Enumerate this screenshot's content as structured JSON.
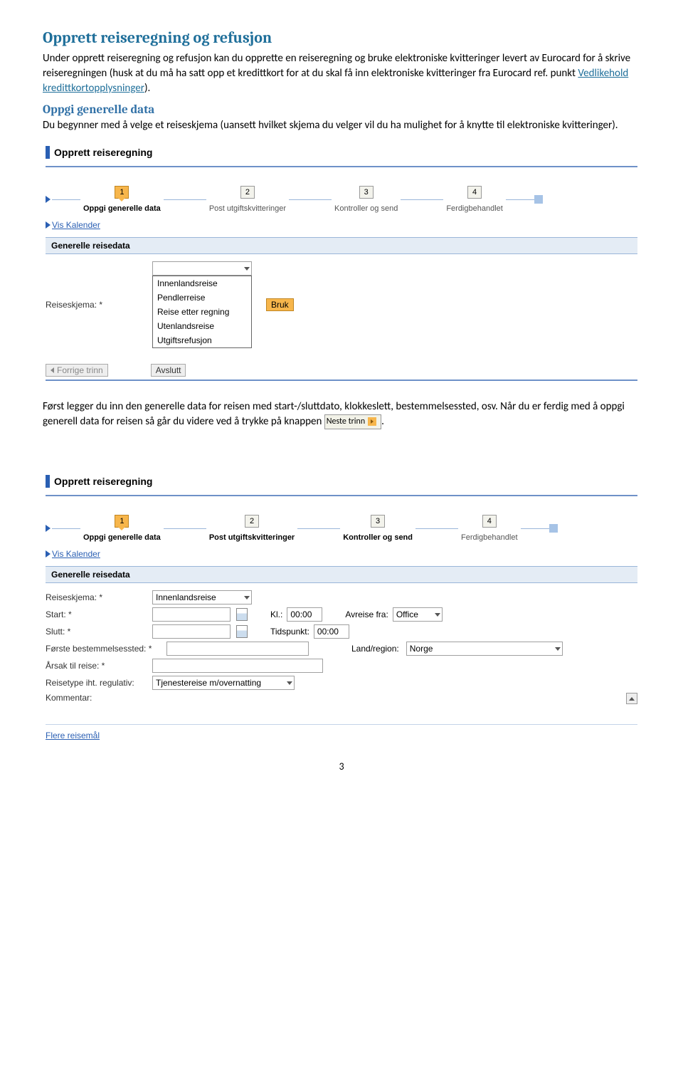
{
  "doc": {
    "h1": "Opprett reiseregning og refusjon",
    "p1a": "Under opprett reiseregning og refusjon kan du opprette en reiseregning og bruke elektroniske kvitteringer levert av Eurocard for å skrive reiseregningen (husk at du må ha satt opp et kredittkort for at du skal få inn elektroniske kvitteringer fra Eurocard ref. punkt ",
    "p1link": "Vedlikehold kredittkortopplysninger",
    "p1b": ").",
    "h2": "Oppgi generelle data",
    "p2": "Du begynner med å velge et reiseskjema (uansett hvilket skjema du velger vil du ha mulighet for å knytte til elektroniske kvitteringer).",
    "p3a": "Først legger du inn den generelle data for reisen med start-/sluttdato, klokkeslett, bestemmelsessted, osv. Når du er ferdig med å oppgi generell data for reisen så går du videre ved å trykke på knappen ",
    "p3btn": "Neste trinn",
    "p3b": ".",
    "pageNum": "3"
  },
  "shot1": {
    "title": "Opprett reiseregning",
    "steps": {
      "s1": "1",
      "s2": "2",
      "s3": "3",
      "s4": "4",
      "l1": "Oppgi generelle data",
      "l2": "Post utgiftskvitteringer",
      "l3": "Kontroller og send",
      "l4": "Ferdigbehandlet"
    },
    "kalender": "Vis Kalender",
    "section": "Generelle reisedata",
    "labelSkjema": "Reiseskjema: *",
    "bruk": "Bruk",
    "options": [
      "Innenlandsreise",
      "Pendlerreise",
      "Reise etter regning",
      "Utenlandsreise",
      "Utgiftsrefusjon"
    ],
    "forrige": "Forrige trinn",
    "avslutt": "Avslutt"
  },
  "shot2": {
    "title": "Opprett reiseregning",
    "steps": {
      "s1": "1",
      "s2": "2",
      "s3": "3",
      "s4": "4",
      "l1": "Oppgi generelle data",
      "l2": "Post utgiftskvitteringer",
      "l3": "Kontroller og send",
      "l4": "Ferdigbehandlet"
    },
    "kalender": "Vis Kalender",
    "section": "Generelle reisedata",
    "rows": {
      "skjema": "Reiseskjema: *",
      "skjemaVal": "Innenlandsreise",
      "start": "Start: *",
      "kl": "Kl.:",
      "klVal": "00:00",
      "avreise": "Avreise fra:",
      "avreiseVal": "Office",
      "slutt": "Slutt: *",
      "tids": "Tidspunkt:",
      "tidsVal": "00:00",
      "bestemmelse": "Første bestemmelsessted: *",
      "land": "Land/region:",
      "landVal": "Norge",
      "arsak": "Årsak til reise: *",
      "regulativ": "Reisetype iht. regulativ:",
      "regulativVal": "Tjenestereise m/overnatting",
      "kommentar": "Kommentar:"
    },
    "flere": "Flere reisemål"
  }
}
